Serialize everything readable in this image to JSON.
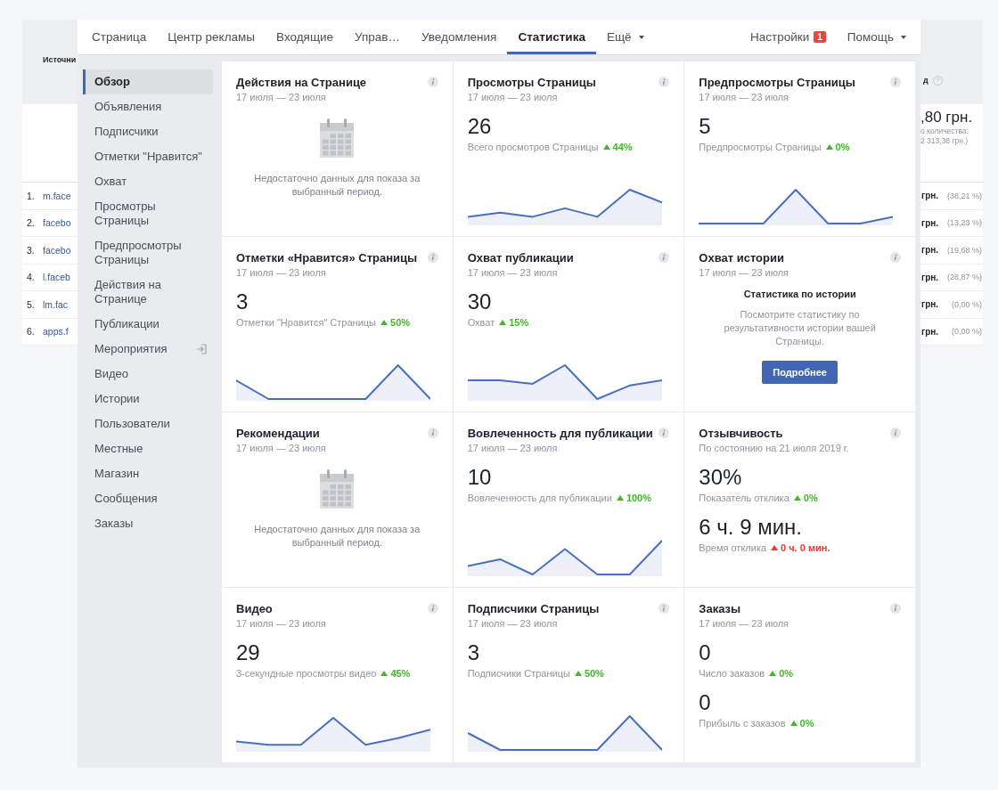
{
  "background_table": {
    "header_left": "Источни",
    "header_right": "д",
    "total": {
      "value": ",80 грн.",
      "note_1": "о количества:",
      "note_2": "2 313,38 грн.)"
    },
    "rows": [
      {
        "index": "1.",
        "source": "m.face",
        "amount": "грн.",
        "share": "(38,21 %)"
      },
      {
        "index": "2.",
        "source": "facebo",
        "amount": "грн.",
        "share": "(13,23 %)"
      },
      {
        "index": "3.",
        "source": "facebo",
        "amount": "грн.",
        "share": "(19,68 %)"
      },
      {
        "index": "4.",
        "source": "l.faceb",
        "amount": "грн.",
        "share": "(28,87 %)"
      },
      {
        "index": "5.",
        "source": "lm.fac",
        "amount": "грн.",
        "share": "(0,00 %)"
      },
      {
        "index": "6.",
        "source": "apps.f",
        "amount": "грн.",
        "share": "(0,00 %)"
      }
    ]
  },
  "nav": {
    "tabs": [
      {
        "label": "Страница",
        "selected": false,
        "dropdown": false
      },
      {
        "label": "Центр рекламы",
        "selected": false,
        "dropdown": false
      },
      {
        "label": "Входящие",
        "selected": false,
        "dropdown": false
      },
      {
        "label": "Управ…",
        "selected": false,
        "dropdown": false
      },
      {
        "label": "Уведомления",
        "selected": false,
        "dropdown": false
      },
      {
        "label": "Статистика",
        "selected": true,
        "dropdown": false
      },
      {
        "label": "Ещё",
        "selected": false,
        "dropdown": true
      }
    ],
    "settings": {
      "label": "Настройки",
      "badge": "1"
    },
    "help": {
      "label": "Помощь",
      "dropdown": true
    }
  },
  "sidebar": {
    "items": [
      {
        "label": "Обзор",
        "selected": true,
        "trailing_icon": false
      },
      {
        "label": "Объявления",
        "selected": false,
        "trailing_icon": false
      },
      {
        "label": "Подписчики",
        "selected": false,
        "trailing_icon": false
      },
      {
        "label": "Отметки \"Нравится\"",
        "selected": false,
        "trailing_icon": false
      },
      {
        "label": "Охват",
        "selected": false,
        "trailing_icon": false
      },
      {
        "label": "Просмотры Страницы",
        "selected": false,
        "trailing_icon": false
      },
      {
        "label": "Предпросмотры Страницы",
        "selected": false,
        "trailing_icon": false
      },
      {
        "label": "Действия на Странице",
        "selected": false,
        "trailing_icon": false
      },
      {
        "label": "Публикации",
        "selected": false,
        "trailing_icon": false
      },
      {
        "label": "Мероприятия",
        "selected": false,
        "trailing_icon": true
      },
      {
        "label": "Видео",
        "selected": false,
        "trailing_icon": false
      },
      {
        "label": "Истории",
        "selected": false,
        "trailing_icon": false
      },
      {
        "label": "Пользователи",
        "selected": false,
        "trailing_icon": false
      },
      {
        "label": "Местные",
        "selected": false,
        "trailing_icon": false
      },
      {
        "label": "Магазин",
        "selected": false,
        "trailing_icon": false
      },
      {
        "label": "Сообщения",
        "selected": false,
        "trailing_icon": false
      },
      {
        "label": "Заказы",
        "selected": false,
        "trailing_icon": false
      }
    ]
  },
  "cards": [
    {
      "kind": "empty",
      "title": "Действия на Странице",
      "subtitle": "17 июля — 23 июля",
      "message": "Недостаточно данных для показа за выбранный период."
    },
    {
      "kind": "metrics",
      "title": "Просмотры Страницы",
      "subtitle": "17 июля — 23 июля",
      "sparkline": true,
      "metrics": [
        {
          "value": "26",
          "label": "Всего просмотров Страницы",
          "change": "44%",
          "color": "#42b72a"
        }
      ]
    },
    {
      "kind": "metrics",
      "title": "Предпросмотры Страницы",
      "subtitle": "17 июля — 23 июля",
      "sparkline": true,
      "metrics": [
        {
          "value": "5",
          "label": "Предпросмотры Страницы",
          "change": "0%",
          "color": "#42b72a"
        }
      ]
    },
    {
      "kind": "metrics",
      "title": "Отметки «Нравится» Страницы",
      "subtitle": "17 июля — 23 июля",
      "sparkline": true,
      "metrics": [
        {
          "value": "3",
          "label": "Отметки \"Нравится\" Страницы",
          "change": "50%",
          "color": "#42b72a"
        }
      ]
    },
    {
      "kind": "metrics",
      "title": "Охват публикации",
      "subtitle": "17 июля — 23 июля",
      "sparkline": true,
      "metrics": [
        {
          "value": "30",
          "label": "Охват",
          "change": "15%",
          "color": "#42b72a"
        }
      ]
    },
    {
      "kind": "promo",
      "title": "Охват истории",
      "subtitle": "17 июля — 23 июля",
      "heading": "Статистика по истории",
      "message": "Посмотрите статистику по результативности истории вашей Страницы.",
      "button": "Подробнее"
    },
    {
      "kind": "empty",
      "title": "Рекомендации",
      "subtitle": "17 июля — 23 июля",
      "message": "Недостаточно данных для показа за выбранный период."
    },
    {
      "kind": "metrics",
      "title": "Вовлеченность для публикации",
      "subtitle": "17 июля — 23 июля",
      "sparkline": true,
      "metrics": [
        {
          "value": "10",
          "label": "Вовлеченность для публикации",
          "change": "100%",
          "color": "#42b72a"
        }
      ]
    },
    {
      "kind": "metrics",
      "title": "Отзывчивость",
      "subtitle": "По состоянию на 21 июля 2019 г.",
      "sparkline": false,
      "metrics": [
        {
          "value": "30%",
          "label": "Показатель отклика",
          "change": "0%",
          "color": "#42b72a"
        },
        {
          "value": "6 ч. 9 мин.",
          "label": "Время отклика",
          "change": "0 ч. 0 мин.",
          "color": "#e03a3a"
        }
      ]
    },
    {
      "kind": "metrics",
      "title": "Видео",
      "subtitle": "17 июля — 23 июля",
      "sparkline": true,
      "metrics": [
        {
          "value": "29",
          "label": "3-секундные просмотры видео",
          "change": "45%",
          "color": "#42b72a"
        }
      ]
    },
    {
      "kind": "metrics",
      "title": "Подписчики Страницы",
      "subtitle": "17 июля — 23 июля",
      "sparkline": true,
      "metrics": [
        {
          "value": "3",
          "label": "Подписчики Страницы",
          "change": "50%",
          "color": "#42b72a"
        }
      ]
    },
    {
      "kind": "metrics",
      "title": "Заказы",
      "subtitle": "17 июля — 23 июля",
      "sparkline": false,
      "metrics": [
        {
          "value": "0",
          "label": "Число заказов",
          "change": "0%",
          "color": "#42b72a"
        },
        {
          "value": "0",
          "label": "Прибыль с заказов",
          "change": "0%",
          "color": "#42b72a"
        }
      ]
    }
  ]
}
